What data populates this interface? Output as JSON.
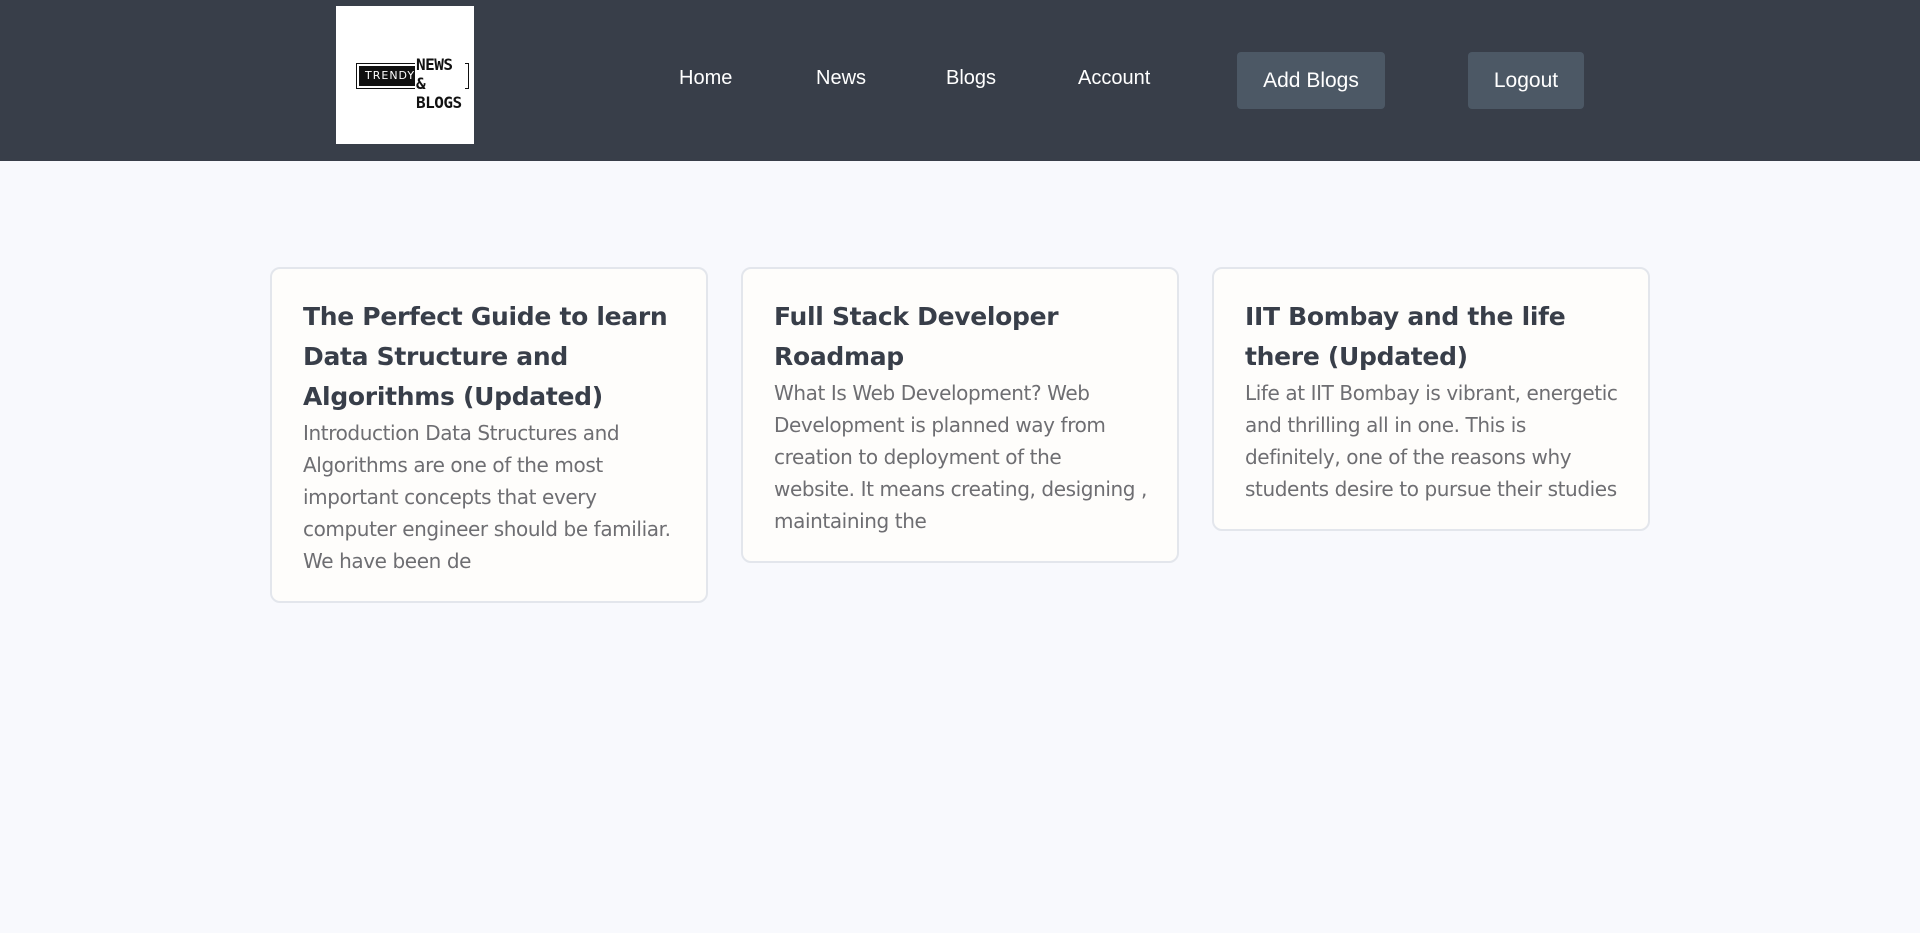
{
  "logo": {
    "tag": "TRENDY",
    "line1": "NEWS &",
    "line2": "BLOGS"
  },
  "nav": {
    "links": [
      "Home",
      "News",
      "Blogs",
      "Account"
    ],
    "add_blogs_label": "Add Blogs",
    "logout_label": "Logout"
  },
  "colors": {
    "navbar_bg": "#383e49",
    "button_bg": "#4c5865",
    "page_bg": "#f8f9fd",
    "card_bg": "#fefdfb",
    "title_color": "#383e49",
    "text_color": "#6e6e72"
  },
  "blogs": [
    {
      "title": "The Perfect Guide to learn Data Structure and Algorithms (Updated)",
      "excerpt": "Introduction Data Structures and Algorithms are one of the most important concepts that every computer engineer should be familiar. We have been de"
    },
    {
      "title": "Full Stack Developer Roadmap",
      "excerpt": "What Is Web Development? Web Development is planned way from creation to deployment of the website. It means creating, designing , maintaining the"
    },
    {
      "title": "IIT Bombay and the life there (Updated)",
      "excerpt": "Life at IIT Bombay is vibrant, energetic and thrilling all in one. This is definitely, one of the reasons why students desire to pursue their studies"
    }
  ]
}
